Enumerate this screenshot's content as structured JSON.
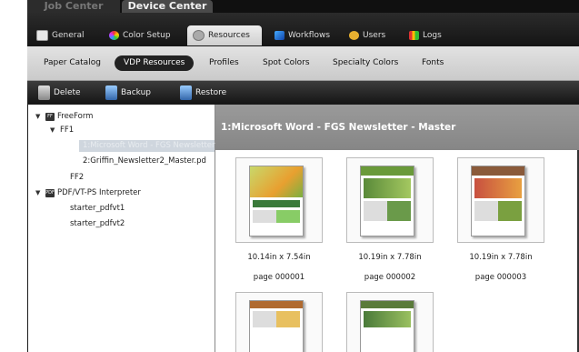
{
  "top_tabs": [
    "Job Center",
    "Device Center"
  ],
  "tabs": [
    {
      "label": "General",
      "icon": "printer-icon"
    },
    {
      "label": "Color Setup",
      "icon": "color-wheel-icon"
    },
    {
      "label": "Resources",
      "icon": "gear-icon"
    },
    {
      "label": "Workflows",
      "icon": "workflow-arrow-icon"
    },
    {
      "label": "Users",
      "icon": "users-icon"
    },
    {
      "label": "Logs",
      "icon": "bar-chart-icon"
    }
  ],
  "subtabs": [
    "Paper Catalog",
    "VDP Resources",
    "Profiles",
    "Spot Colors",
    "Specialty Colors",
    "Fonts"
  ],
  "toolbar": {
    "delete": "Delete",
    "backup": "Backup",
    "restore": "Restore"
  },
  "tree": {
    "freeform": "FreeForm",
    "ff1": "FF1",
    "ff1_item1": "1:Microsoft Word - FGS Newsletter",
    "ff1_item2": "2:Griffin_Newsletter2_Master.pd",
    "ff2": "FF2",
    "pdf": "PDF/VT-PS Interpreter",
    "starter1": "starter_pdfvt1",
    "starter2": "starter_pdfvt2"
  },
  "panel_title": "1:Microsoft Word - FGS Newsletter - Master",
  "thumbnails": [
    {
      "size": "10.14in x 7.54in",
      "page": "page 000001"
    },
    {
      "size": "10.19in x 7.78in",
      "page": "page 000002"
    },
    {
      "size": "10.19in x 7.78in",
      "page": "page 000003"
    }
  ],
  "colors": {
    "accent_selected": "#cfd6de",
    "dark_bg": "#1b1b1b"
  }
}
